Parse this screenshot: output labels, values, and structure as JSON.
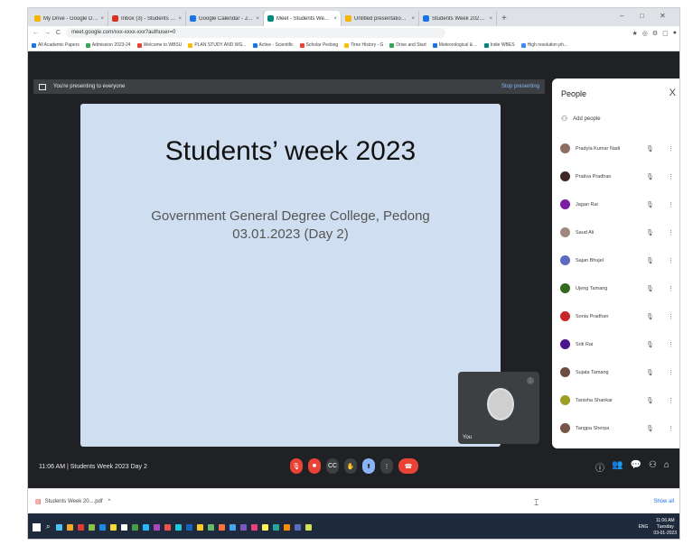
{
  "browser": {
    "tabs": [
      {
        "title": "My Drive - Google Drive",
        "color": "#f4b400",
        "active": false
      },
      {
        "title": "Inbox (3) - Students Week",
        "color": "#d93025",
        "active": false
      },
      {
        "title": "Google Calendar - January 2023",
        "color": "#1a73e8",
        "active": false
      },
      {
        "title": "Meet - Students Week 2023",
        "color": "#00897b",
        "active": true
      },
      {
        "title": "Untitled presentation - Google Slides",
        "color": "#f4b400",
        "active": false
      },
      {
        "title": "Students Week 2023 Notice - Google Docs",
        "color": "#1a73e8",
        "active": false
      }
    ],
    "new_tab": "+",
    "window_controls": [
      "–",
      "□",
      "✕"
    ],
    "nav": [
      "←",
      "→",
      "C"
    ],
    "url": "meet.google.com/xxx-xxxx-xxx?authuser=0",
    "toolbar_icons": [
      "★",
      "◎",
      "⚙",
      "▢",
      "●"
    ],
    "bookmarks": [
      "All Academic Papers",
      "Admission 2023-24",
      "Welcome to WBSU",
      "PLAN STUDY AND WG...",
      "Active - Scientific",
      "Scholar Pedong",
      "Time History - G",
      "Drive and Start",
      "Meteorological & ...",
      "Indie WBES",
      "High resolution ph..."
    ]
  },
  "meet": {
    "presenting_text": "You're presenting to everyone",
    "stop_presenting": "Stop presenting",
    "slide": {
      "title": "Students’ week 2023",
      "subtitle1": "Government General Degree College, Pedong",
      "subtitle2": "03.01.2023 (Day 2)"
    },
    "self_view": {
      "name": "You",
      "mic": "⋮"
    },
    "people_panel": {
      "title": "People",
      "close": "X",
      "add_people": "Add people",
      "add_icon": "⚇",
      "participants": [
        {
          "name": "Pradyla Kumar Nadi",
          "color": "#8d6e63"
        },
        {
          "name": "Prativa Pradhan",
          "color": "#3e2723"
        },
        {
          "name": "Jagan Rai",
          "color": "#7b1fa2"
        },
        {
          "name": "Saud Ali",
          "color": "#a1887f"
        },
        {
          "name": "Sajan Bhujel",
          "color": "#5c6bc0"
        },
        {
          "name": "Ujeng Tamang",
          "color": "#33691e"
        },
        {
          "name": "Sonia Pradhan",
          "color": "#c62828"
        },
        {
          "name": "Sriti Rai",
          "color": "#4a148c"
        },
        {
          "name": "Sujata Tamang",
          "color": "#6d4c41"
        },
        {
          "name": "Tanisha Shankar",
          "color": "#9e9d24"
        },
        {
          "name": "Tangpa Sherpa",
          "color": "#795548"
        }
      ],
      "mic_icon": "🎙",
      "more_icon": "⋮"
    },
    "meeting_info": "11:06 AM  |  Students Week 2023 Day 2",
    "controls": {
      "mic": "🎙",
      "camera": "■",
      "captions": "CC",
      "raise_hand": "✋",
      "present": "⬆",
      "more": "⋮",
      "end_call": "☎"
    },
    "right_icons": [
      "ⓘ",
      "👥",
      "💬",
      "⚇",
      "⌂"
    ]
  },
  "download_bar": {
    "file": "Students Week 20....pdf",
    "file_icon": "▤",
    "caret": "^",
    "cursor": "⌶",
    "show_all": "Show all"
  },
  "taskbar": {
    "search_icon": "⌕",
    "app_colors": [
      "#4fc3f7",
      "#f9a825",
      "#e53935",
      "#8bc34a",
      "#1e88e5",
      "#fdd835",
      "#ffffff",
      "#43a047",
      "#29b6f6",
      "#ab47bc",
      "#ef5350",
      "#26c6da",
      "#1565c0",
      "#ffca28",
      "#66bb6a",
      "#ff7043",
      "#42a5f5",
      "#7e57c2",
      "#ec407a",
      "#ffee58",
      "#26a69a",
      "#fb8c00",
      "#5c6bc0",
      "#d4e157"
    ],
    "tray_text": "ENG",
    "clock_time": "11:06 AM",
    "clock_day": "Tuesday",
    "clock_date": "03-01-2023"
  }
}
